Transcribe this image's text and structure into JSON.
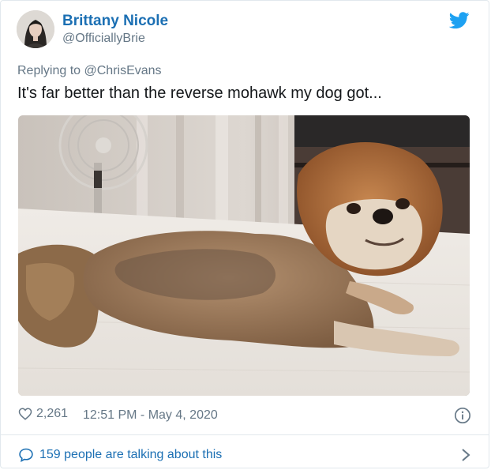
{
  "tweet": {
    "author_name": "Brittany Nicole",
    "author_handle": "@OfficiallyBrie",
    "reply_prefix": "Replying to ",
    "reply_to": "@ChrisEvans",
    "text": "It's far better than the reverse mohawk my dog got...",
    "like_count": "2,261",
    "timestamp": "12:51 PM - May 4, 2020",
    "conversation_text": "159 people are talking about this"
  },
  "icons": {
    "brand": "twitter-bird-icon",
    "like": "heart-icon",
    "info": "info-icon",
    "conversation": "speech-bubble-icon",
    "more": "chevron-right-icon"
  },
  "colors": {
    "accent": "#1b6fb3",
    "twitter_blue": "#1da1f2",
    "muted": "#657786",
    "text": "#14171a",
    "border": "#e1e8ed"
  }
}
